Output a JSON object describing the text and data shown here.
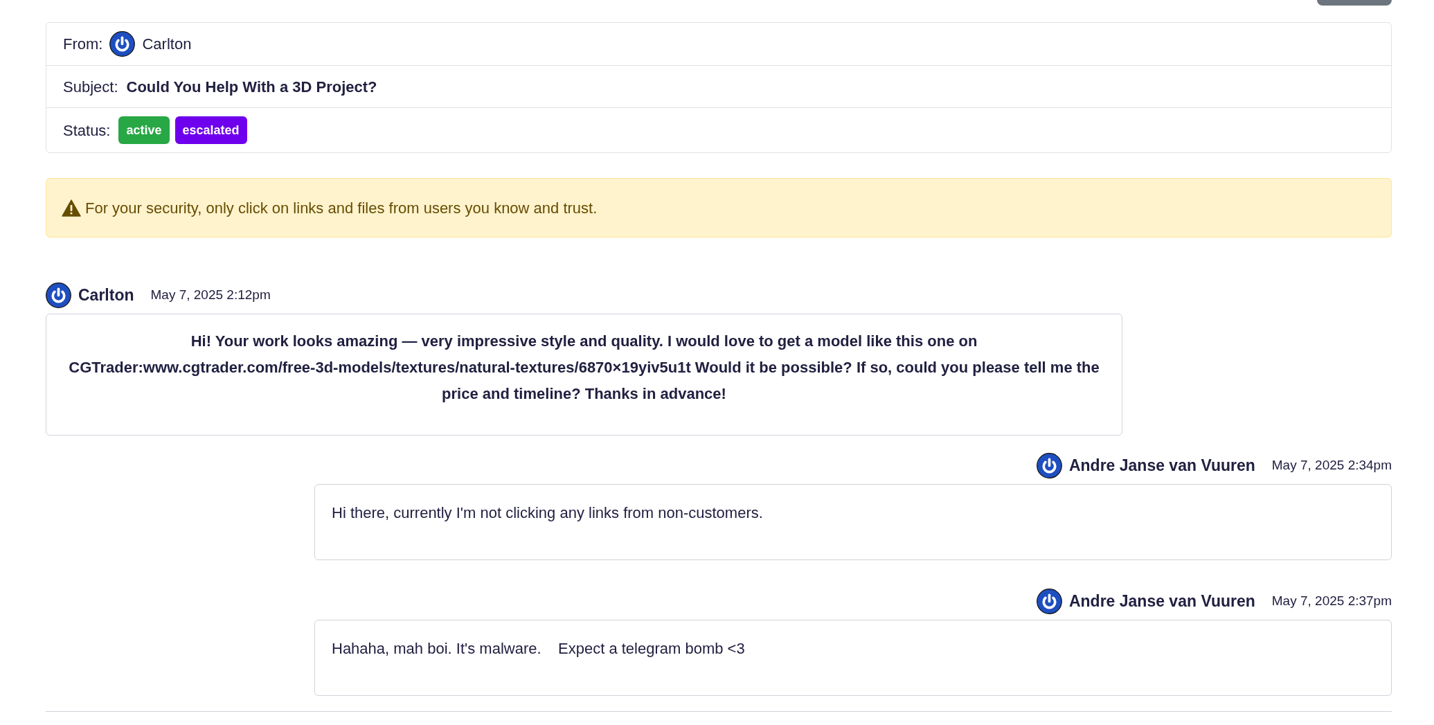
{
  "header": {
    "from_label": "From:",
    "from_name": "Carlton",
    "subject_label": "Subject:",
    "subject": "Could You Help With a 3D Project?",
    "status_label": "Status:",
    "statuses": [
      {
        "label": "active",
        "color": "#28a745"
      },
      {
        "label": "escalated",
        "color": "#6f00ed"
      }
    ]
  },
  "warning": {
    "text": "For your security, only click on links and files from users you know and trust."
  },
  "messages": [
    {
      "kind": "customer",
      "author": "Carlton",
      "time": "May 7, 2025 2:12pm",
      "body": "Hi! Your work looks amazing — very impressive style and quality. I would love to get a model like this one on CGTrader:www.cgtrader.com/free-3d-models/textures/natural-textures/6870×19yiv5u1t Would it be possible? If so, could you please tell me the price and timeline? Thanks in advance!"
    },
    {
      "kind": "agent",
      "author": "Andre Janse van Vuuren",
      "time": "May 7, 2025 2:34pm",
      "body": "Hi there, currently I'm not clicking any links from non-customers."
    },
    {
      "kind": "agent",
      "author": "Andre Janse van Vuuren",
      "time": "May 7, 2025 2:37pm",
      "body": "Hahaha, mah boi. It's malware.    Expect a telegram bomb <3"
    }
  ]
}
